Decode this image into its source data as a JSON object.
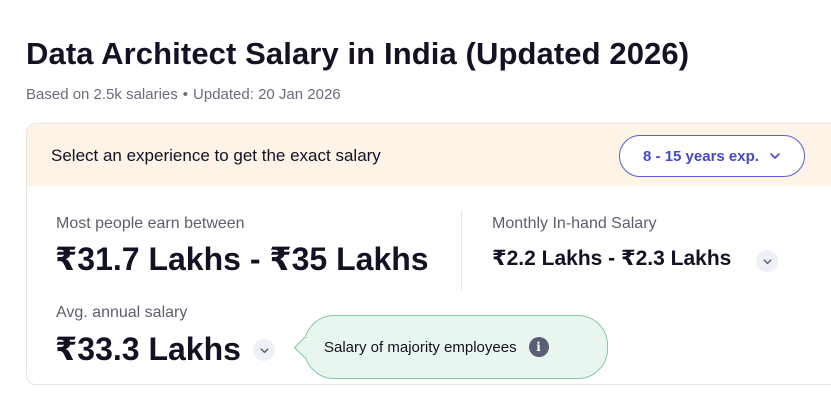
{
  "header": {
    "title": "Data Architect Salary in India (Updated 2026)",
    "based_on": "Based on 2.5k salaries",
    "separator": "•",
    "updated": "Updated: 20 Jan 2026"
  },
  "experience": {
    "prompt": "Select an experience to get the exact salary",
    "selected": "8 - 15 years exp."
  },
  "salary": {
    "range_label": "Most people earn between",
    "range_value": "₹31.7 Lakhs - ₹35 Lakhs",
    "monthly_label": "Monthly In-hand Salary",
    "monthly_value": "₹2.2 Lakhs - ₹2.3 Lakhs",
    "avg_label": "Avg. annual salary",
    "avg_value": "₹33.3 Lakhs"
  },
  "tooltip": {
    "text": "Salary of majority employees",
    "info_glyph": "i"
  },
  "colors": {
    "accent": "#4549c9",
    "banner_bg": "#fdf3e6",
    "tooltip_bg": "#e9f6ef",
    "tooltip_border": "#7fcaa1"
  }
}
